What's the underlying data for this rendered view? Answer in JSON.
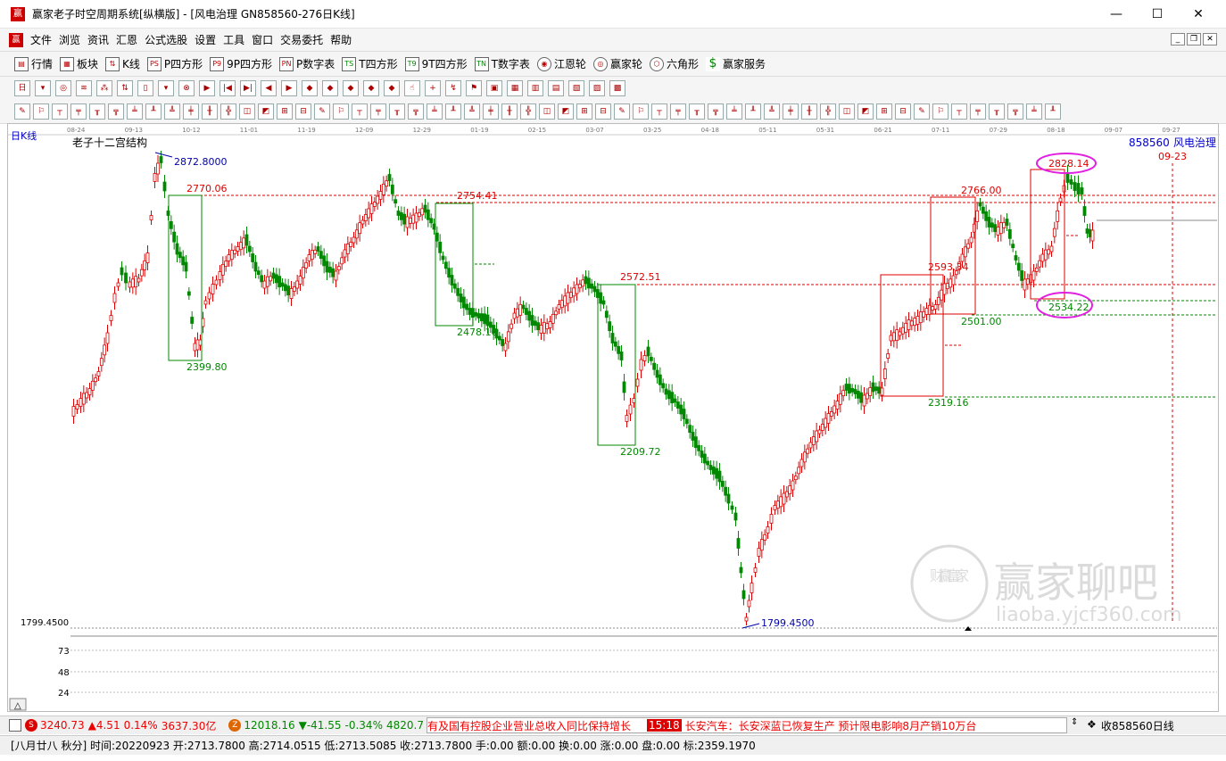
{
  "window": {
    "title": "赢家老子时空周期系统[纵横版] - [风电治理  GN858560-276日K线]",
    "app_icon": "赢"
  },
  "menu": {
    "items": [
      "文件",
      "浏览",
      "资讯",
      "汇恩",
      "公式选股",
      "设置",
      "工具",
      "窗口",
      "交易委托",
      "帮助"
    ]
  },
  "toolbar1": {
    "items": [
      {
        "icon": "quote-icon",
        "label": "行情"
      },
      {
        "icon": "sector-icon",
        "label": "板块"
      },
      {
        "icon": "kline-icon",
        "label": "K线"
      },
      {
        "icon": "ps-icon",
        "label": "P四方形",
        "badge": "PS"
      },
      {
        "icon": "p9-icon",
        "label": "9P四方形",
        "badge": "P9"
      },
      {
        "icon": "pn-icon",
        "label": "P数字表",
        "badge": "PN"
      },
      {
        "icon": "ts-icon",
        "label": "T四方形",
        "badge": "TS"
      },
      {
        "icon": "t9-icon",
        "label": "9T四方形",
        "badge": "T9"
      },
      {
        "icon": "tn-icon",
        "label": "T数字表",
        "badge": "TN"
      },
      {
        "icon": "wheel-icon",
        "label": "江恩轮"
      },
      {
        "icon": "winner-wheel-icon",
        "label": "赢家轮"
      },
      {
        "icon": "hexagon-icon",
        "label": "六角形"
      },
      {
        "icon": "dollar-icon",
        "label": "赢家服务"
      }
    ]
  },
  "chart": {
    "period_label": "日K线",
    "title": "老子十二宫结构",
    "code": "858560",
    "name": "风电治理",
    "date_marker": "09-23",
    "y_axis_label": "1799.4500",
    "volume_labels": [
      "73",
      "48",
      "24"
    ],
    "x_labels": [
      "08-24",
      "09-13",
      "10-12",
      "11-01",
      "11-19",
      "12-09",
      "12-29",
      "01-19",
      "02-15",
      "03-07",
      "03-25",
      "04-18",
      "05-11",
      "05-31",
      "06-21",
      "07-11",
      "07-29",
      "08-18",
      "09-07",
      "09-27"
    ],
    "annotations": {
      "hi1": "2872.8000",
      "p2770": "2770.06",
      "p2399": "2399.80",
      "p2754": "2754.41",
      "p2478": "2478.16",
      "p2572": "2572.51",
      "p2209": "2209.72",
      "low": "1799.4500",
      "p2766": "2766.00",
      "p2593": "2593.34",
      "p2501": "2501.00",
      "p2319": "2319.16",
      "p2828": "2828.14",
      "p2534": "2534.22"
    },
    "watermark": {
      "cn": "赢家聊吧",
      "url": "liaoba.yjcf360.com",
      "seal": "财赢富家"
    }
  },
  "status1": {
    "index1": {
      "value": "3240.73",
      "change": "▲4.51",
      "pct": "0.14%",
      "amount": "3637.30亿"
    },
    "index2": {
      "value": "12018.16",
      "change": "▼-41.55",
      "pct": "-0.34%",
      "amount": "4820.7"
    },
    "ticker1": "有及国有控股企业营业总收入同比保持增长",
    "time": "15:18",
    "ticker2": "长安汽车：长安深蓝已恢复生产 预计限电影响8月产销10万台",
    "right": "收858560日线"
  },
  "status2": {
    "text": "[八月廿八 秋分] 时间:20220923 开:2713.7800 高:2714.0515 低:2713.5085 收:2713.7800 手:0.00 额:0.00 换:0.00 涨:0.00 盘:0.00 标:2359.1970"
  }
}
